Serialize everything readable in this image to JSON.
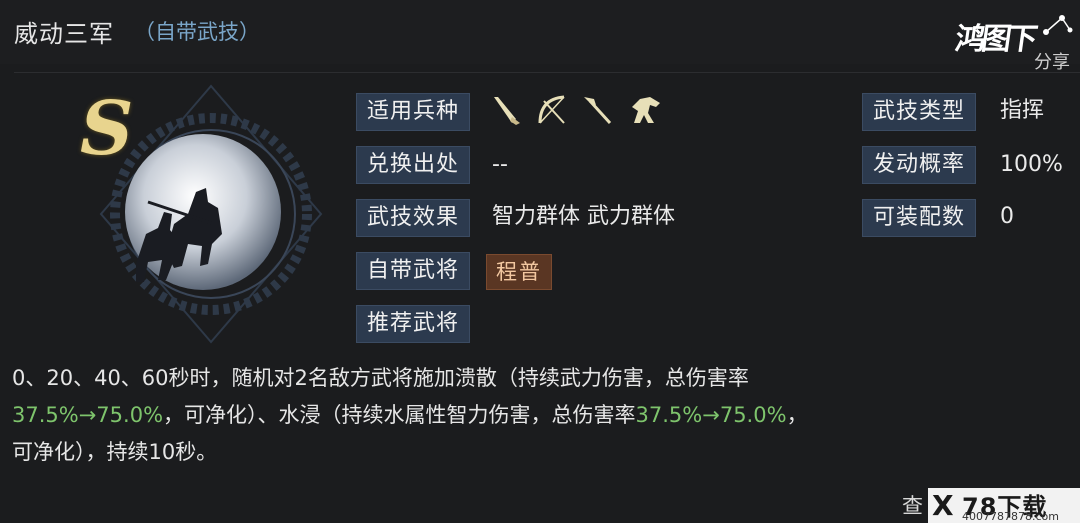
{
  "skill": {
    "name": "威动三军",
    "tag": "（自带武技）",
    "rank": "S"
  },
  "logo": {
    "text": "鸿图下",
    "sub": "分享"
  },
  "fields": {
    "troop_label": "适用兵种",
    "troops": [
      "spear-icon",
      "bow-icon",
      "halberd-icon",
      "cavalry-icon"
    ],
    "source_label": "兑换出处",
    "source_value": "--",
    "effect_label": "武技效果",
    "effect_value": "智力群体 武力群体",
    "own_general_label": "自带武将",
    "own_general_value": "程普",
    "recommend_label": "推荐武将",
    "type_label": "武技类型",
    "type_value": "指挥",
    "chance_label": "发动概率",
    "chance_value": "100%",
    "equip_label": "可装配数",
    "equip_value": "0"
  },
  "description": {
    "part1": "0、20、40、60秒时，随机对2名敌方武将施加溃散（持续武力伤害，总伤害率",
    "rate1": "37.5%→75.0%",
    "part2": "，可净化）、水浸（持续水属性智力伤害，总伤害率",
    "rate2": "37.5%→75.0%",
    "part3": "，",
    "part4": "可净化），持续10秒。"
  },
  "more_link": "查",
  "watermark": {
    "brand": "78下载",
    "mark": "X",
    "url": "4007787878.com"
  },
  "colors": {
    "label_bg": "#2c3a4e",
    "highlight_green": "#7ec46c",
    "tag_blue": "#7aa6c9",
    "rank_gold": "#e8d48e",
    "general_chip_bg": "#5a3623"
  }
}
